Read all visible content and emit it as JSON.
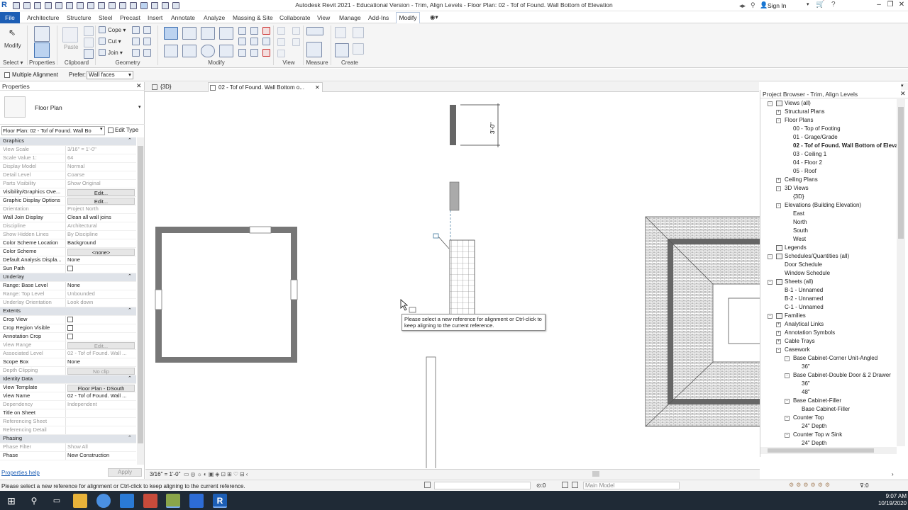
{
  "window": {
    "title": "Autodesk Revit 2021 - Educational Version - Trim, Align Levels - Floor Plan: 02 - Tof of Found. Wall Bottom of Elevation",
    "signin": "Sign In"
  },
  "menu": {
    "file": "File",
    "tabs": [
      "Architecture",
      "Structure",
      "Steel",
      "Precast",
      "Insert",
      "Annotate",
      "Analyze",
      "Massing & Site",
      "Collaborate",
      "View",
      "Manage",
      "Add-Ins"
    ],
    "active": "Modify"
  },
  "ribbon": {
    "modify_label": "Modify",
    "select_label": "Select",
    "paste_label": "Paste",
    "cope_label": "Cope",
    "cut_label": "Cut",
    "join_label": "Join",
    "groups": {
      "select": "Select",
      "properties": "Properties",
      "clipboard": "Clipboard",
      "geometry": "Geometry",
      "modify": "Modify",
      "view": "View",
      "measure": "Measure",
      "create": "Create"
    }
  },
  "options": {
    "multiple_alignment": "Multiple Alignment",
    "prefer_label": "Prefer:",
    "prefer_value": "Wall faces"
  },
  "properties": {
    "header": "Properties",
    "type_name": "Floor Plan",
    "instance": "Floor Plan: 02 - Tof of Found. Wall Bo",
    "edit_type": "Edit Type",
    "help": "Properties help",
    "apply": "Apply",
    "rows": [
      {
        "k": "Graphics",
        "sec": true
      },
      {
        "k": "View Scale",
        "v": "3/16\" = 1'-0\"",
        "gray": true
      },
      {
        "k": "Scale Value    1:",
        "v": "64",
        "gray": true
      },
      {
        "k": "Display Model",
        "v": "Normal",
        "gray": true
      },
      {
        "k": "Detail Level",
        "v": "Coarse",
        "gray": true
      },
      {
        "k": "Parts Visibility",
        "v": "Show Original",
        "gray": true
      },
      {
        "k": "Visibility/Graphics Ove...",
        "v": "Edit...",
        "btn": true
      },
      {
        "k": "Graphic Display Options",
        "v": "Edit...",
        "btn": true
      },
      {
        "k": "Orientation",
        "v": "Project North",
        "gray": true
      },
      {
        "k": "Wall Join Display",
        "v": "Clean all wall joins"
      },
      {
        "k": "Discipline",
        "v": "Architectural",
        "gray": true
      },
      {
        "k": "Show Hidden Lines",
        "v": "By Discipline",
        "gray": true
      },
      {
        "k": "Color Scheme Location",
        "v": "Background"
      },
      {
        "k": "Color Scheme",
        "v": "<none>",
        "btn": true
      },
      {
        "k": "Default Analysis Displa...",
        "v": "None"
      },
      {
        "k": "Sun Path",
        "v": "",
        "chk": true
      },
      {
        "k": "Underlay",
        "sec": true
      },
      {
        "k": "Range: Base Level",
        "v": "None"
      },
      {
        "k": "Range: Top Level",
        "v": "Unbounded",
        "gray": true
      },
      {
        "k": "Underlay Orientation",
        "v": "Look down",
        "gray": true
      },
      {
        "k": "Extents",
        "sec": true
      },
      {
        "k": "Crop View",
        "v": "",
        "chk": true
      },
      {
        "k": "Crop Region Visible",
        "v": "",
        "chk": true
      },
      {
        "k": "Annotation Crop",
        "v": "",
        "chk": true
      },
      {
        "k": "View Range",
        "v": "Edit...",
        "btn": true,
        "gray": true
      },
      {
        "k": "Associated Level",
        "v": "02 - Tof of Found. Wall ...",
        "gray": true
      },
      {
        "k": "Scope Box",
        "v": "None"
      },
      {
        "k": "Depth Clipping",
        "v": "No clip",
        "btn": true,
        "gray": true
      },
      {
        "k": "Identity Data",
        "sec": true
      },
      {
        "k": "View Template",
        "v": "Floor Plan - DSouth",
        "btn": true
      },
      {
        "k": "View Name",
        "v": "02 - Tof of Found. Wall ..."
      },
      {
        "k": "Dependency",
        "v": "Independent",
        "gray": true
      },
      {
        "k": "Title on Sheet",
        "v": ""
      },
      {
        "k": "Referencing Sheet",
        "v": "",
        "gray": true
      },
      {
        "k": "Referencing Detail",
        "v": "",
        "gray": true
      },
      {
        "k": "Phasing",
        "sec": true
      },
      {
        "k": "Phase Filter",
        "v": "Show All",
        "gray": true
      },
      {
        "k": "Phase",
        "v": "New Construction"
      }
    ]
  },
  "view_tabs": [
    {
      "label": "{3D}"
    },
    {
      "label": "02 - Tof of Found. Wall Bottom o..."
    }
  ],
  "canvas": {
    "dimension": "3'-0\"",
    "tooltip": "Please select a new reference for alignment or Ctrl-click to keep aligning to the current reference."
  },
  "view_control": {
    "scale": "3/16\" = 1'-0\""
  },
  "project_browser": {
    "header": "Project Browser - Trim, Align Levels",
    "tree": [
      {
        "t": "Views (all)",
        "d": 0,
        "g": "-",
        "icon": true
      },
      {
        "t": "Structural Plans",
        "d": 1,
        "g": "+"
      },
      {
        "t": "Floor Plans",
        "d": 1,
        "g": "-"
      },
      {
        "t": "00 - Top of Footing",
        "d": 2
      },
      {
        "t": "01 - Grage/Grade",
        "d": 2
      },
      {
        "t": "02 - Tof of Found. Wall Bottom of Elevation",
        "d": 2,
        "bold": true
      },
      {
        "t": "03 - Ceiling 1",
        "d": 2
      },
      {
        "t": "04 - Floor 2",
        "d": 2
      },
      {
        "t": "05 - Roof",
        "d": 2
      },
      {
        "t": "Ceiling Plans",
        "d": 1,
        "g": "+"
      },
      {
        "t": "3D Views",
        "d": 1,
        "g": "-"
      },
      {
        "t": "{3D}",
        "d": 2
      },
      {
        "t": "Elevations (Building Elevation)",
        "d": 1,
        "g": "-"
      },
      {
        "t": "East",
        "d": 2
      },
      {
        "t": "North",
        "d": 2
      },
      {
        "t": "South",
        "d": 2
      },
      {
        "t": "West",
        "d": 2
      },
      {
        "t": "Legends",
        "d": 0,
        "icon": true
      },
      {
        "t": "Schedules/Quantities (all)",
        "d": 0,
        "g": "-",
        "icon": true
      },
      {
        "t": "Door Schedule",
        "d": 1
      },
      {
        "t": "Window Schedule",
        "d": 1
      },
      {
        "t": "Sheets (all)",
        "d": 0,
        "g": "-",
        "icon": true
      },
      {
        "t": "B-1 - Unnamed",
        "d": 1
      },
      {
        "t": "B-2 - Unnamed",
        "d": 1
      },
      {
        "t": "C-1 - Unnamed",
        "d": 1
      },
      {
        "t": "Families",
        "d": 0,
        "g": "-",
        "icon": true
      },
      {
        "t": "Analytical Links",
        "d": 1,
        "g": "+"
      },
      {
        "t": "Annotation Symbols",
        "d": 1,
        "g": "+"
      },
      {
        "t": "Cable Trays",
        "d": 1,
        "g": "+"
      },
      {
        "t": "Casework",
        "d": 1,
        "g": "-"
      },
      {
        "t": "Base Cabinet-Corner Unit-Angled",
        "d": 2,
        "g": "-"
      },
      {
        "t": "36\"",
        "d": 3
      },
      {
        "t": "Base Cabinet-Double Door & 2 Drawer",
        "d": 2,
        "g": "-"
      },
      {
        "t": "36\"",
        "d": 3
      },
      {
        "t": "48\"",
        "d": 3
      },
      {
        "t": "Base Cabinet-Filler",
        "d": 2,
        "g": "-"
      },
      {
        "t": "Base Cabinet-Filler",
        "d": 3
      },
      {
        "t": "Counter Top",
        "d": 2,
        "g": "-"
      },
      {
        "t": "24\" Depth",
        "d": 3
      },
      {
        "t": "Counter Top w Sink",
        "d": 2,
        "g": "-"
      },
      {
        "t": "24\" Depth",
        "d": 3
      }
    ]
  },
  "status": {
    "message": "Please select a new reference for alignment or Ctrl-click to keep aligning to the current reference.",
    "zero": ":0",
    "model": "Main Model",
    "filter": ":0"
  },
  "taskbar": {
    "time": "9:07 AM",
    "date": "10/19/2020"
  }
}
